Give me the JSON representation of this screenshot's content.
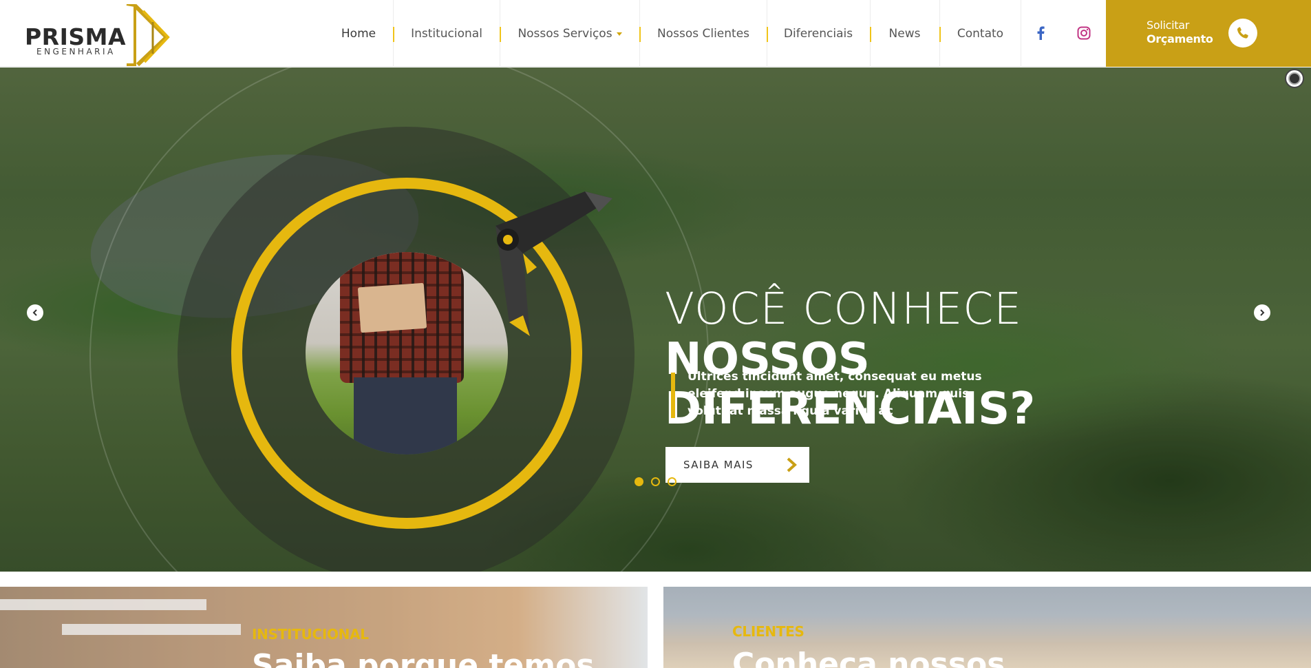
{
  "brand": {
    "name": "PRISMA",
    "tagline": "ENGENHARIA",
    "accent_color": "#e6b80f",
    "cta_color": "#c9a016"
  },
  "nav": {
    "items": [
      {
        "label": "Home",
        "active": true
      },
      {
        "label": "Institucional"
      },
      {
        "label": "Nossos Serviços",
        "has_dropdown": true
      },
      {
        "label": "Nossos Clientes"
      },
      {
        "label": "Diferenciais"
      },
      {
        "label": "News"
      },
      {
        "label": "Contato"
      }
    ],
    "social": [
      {
        "icon": "facebook-icon",
        "color": "#3b66c4"
      },
      {
        "icon": "instagram-icon",
        "color": "#c13584"
      }
    ]
  },
  "cta": {
    "line1": "Solicitar",
    "line2": "Orçamento",
    "icon": "whatsapp-icon"
  },
  "hero": {
    "title_light": "VOCÊ CONHECE",
    "title_bold_1": "NOSSOS",
    "title_bold_2": "DIFERENCIAIS?",
    "description": "Ultrices tincidunt amet, consequat eu metus eleifend ipsum augue neque. Aliquam quis volutpat massa ligula varius ac",
    "button_label": "SAIBA MAIS",
    "slides_total": 3,
    "active_slide": 1
  },
  "cards": [
    {
      "kicker": "INSTITUCIONAL",
      "title": "Saiba porque temos"
    },
    {
      "kicker": "CLIENTES",
      "title": "Conheça nossos"
    }
  ]
}
